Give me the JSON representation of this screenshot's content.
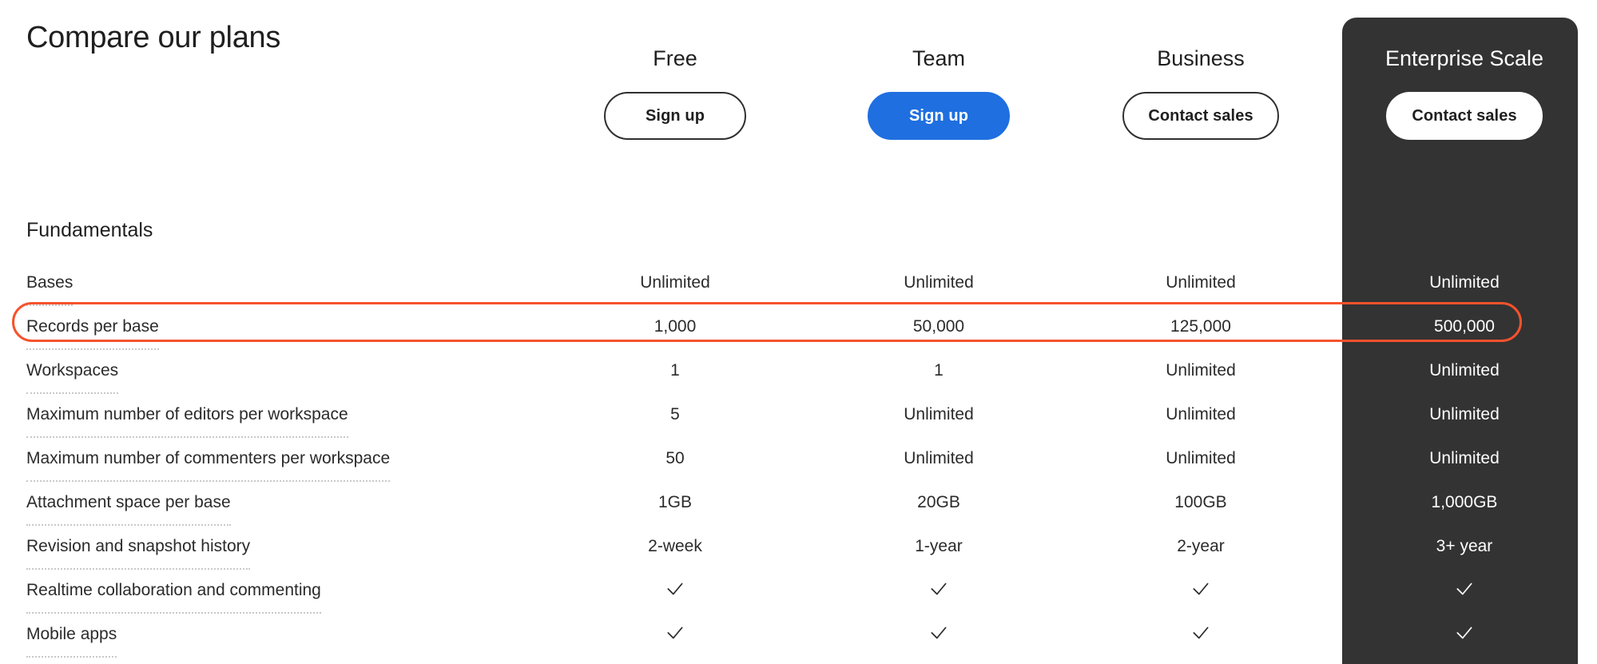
{
  "page": {
    "title": "Compare our plans",
    "section_heading": "Fundamentals"
  },
  "colors": {
    "featured_panel_bg": "#333333",
    "primary_button": "#1f6fe0",
    "annotation_highlight": "#f6522d",
    "text": "#1f1f1f",
    "dotted_rule": "#c9c9c9"
  },
  "plans": [
    {
      "name": "Free",
      "cta": "Sign up",
      "cta_style": "outline",
      "featured": false
    },
    {
      "name": "Team",
      "cta": "Sign up",
      "cta_style": "solid",
      "featured": false
    },
    {
      "name": "Business",
      "cta": "Contact sales",
      "cta_style": "outline",
      "featured": false
    },
    {
      "name": "Enterprise Scale",
      "cta": "Contact sales",
      "cta_style": "light",
      "featured": true
    }
  ],
  "features": [
    {
      "label": "Bases",
      "values": [
        "Unlimited",
        "Unlimited",
        "Unlimited",
        "Unlimited"
      ],
      "highlighted": false
    },
    {
      "label": "Records per base",
      "values": [
        "1,000",
        "50,000",
        "125,000",
        "500,000"
      ],
      "highlighted": true
    },
    {
      "label": "Workspaces",
      "values": [
        "1",
        "1",
        "Unlimited",
        "Unlimited"
      ],
      "highlighted": false
    },
    {
      "label": "Maximum number of editors per workspace",
      "values": [
        "5",
        "Unlimited",
        "Unlimited",
        "Unlimited"
      ],
      "highlighted": false
    },
    {
      "label": "Maximum number of commenters per workspace",
      "values": [
        "50",
        "Unlimited",
        "Unlimited",
        "Unlimited"
      ],
      "highlighted": false
    },
    {
      "label": "Attachment space per base",
      "values": [
        "1GB",
        "20GB",
        "100GB",
        "1,000GB"
      ],
      "highlighted": false
    },
    {
      "label": "Revision and snapshot history",
      "values": [
        "2-week",
        "1-year",
        "2-year",
        "3+ year"
      ],
      "highlighted": false
    },
    {
      "label": "Realtime collaboration and commenting",
      "values": [
        "check",
        "check",
        "check",
        "check"
      ],
      "highlighted": false
    },
    {
      "label": "Mobile apps",
      "values": [
        "check",
        "check",
        "check",
        "check"
      ],
      "highlighted": false
    }
  ],
  "icons": {
    "check": "check-icon"
  }
}
